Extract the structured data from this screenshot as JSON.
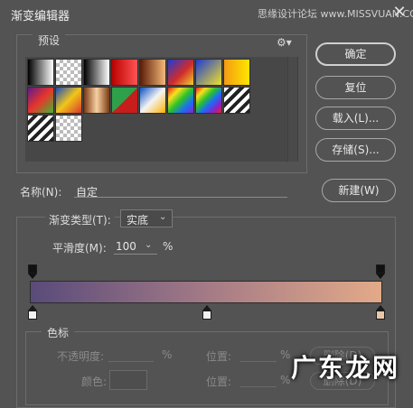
{
  "window": {
    "title": "渐变编辑器",
    "watermark": "思缘设计论坛 www.MISSVUAN.COM",
    "close_glyph": "✕"
  },
  "presets": {
    "label": "预设",
    "gear_glyph": "⚙▾",
    "swatches": [
      "linear-gradient(to right,#000,#fff)",
      "checker",
      "linear-gradient(to right,#000,#fff)",
      "linear-gradient(to right,#b00,#f55)",
      "linear-gradient(to right,#5b1c06,#f4b97a)",
      "linear-gradient(135deg,#1f3bd1 0%,#d12b2b 55%,#f0d12b 100%)",
      "linear-gradient(135deg,#1f3bd1 0%,#f0e12b 100%)",
      "linear-gradient(to right,#f39b12,#ffe600)",
      "linear-gradient(135deg,#5c1a8c 0%,#e8352b 50%,#48b232 100%)",
      "linear-gradient(135deg,#1a4dbf 0%,#f2c519 50%,#d93a2c 100%)",
      "linear-gradient(to right,#7a3a14,#f7d0a2,#7a3a14)",
      "linear-gradient(135deg,#2ea04a 50%,#c81d1d 50%)",
      "linear-gradient(135deg,#0a4fc2,#f4f4f4,#ffb000)",
      "linear-gradient(135deg,#e62222,#f7e11b,#2ac22a,#1b6df7,#8a22c7)",
      "linear-gradient(135deg,#e62222,#f7e11b,#2ac22a,#1b6df7,#8a22c7,#e62222)",
      "repeating-linear-gradient(135deg,#fff 0 4px,#222 4px 8px)",
      "repeating-linear-gradient(135deg,#fff 0 4px,#222 4px 8px)",
      "checker"
    ]
  },
  "buttons": {
    "ok": "确定",
    "reset": "复位",
    "load": "载入(L)...",
    "save": "存储(S)...",
    "new": "新建(W)"
  },
  "name": {
    "label": "名称(N):",
    "value": "自定"
  },
  "gradient_type": {
    "label": "渐变类型(T):",
    "value": "实底",
    "arrow": "⌄"
  },
  "smoothness": {
    "label": "平滑度(M):",
    "value": "100",
    "arrow": "⌄",
    "unit": "%"
  },
  "gradient": {
    "colors": [
      "#594b7a",
      "#a37a86",
      "#e3aa88"
    ],
    "opacity_stops": [
      0,
      100
    ],
    "color_stops": [
      {
        "position_pct": 0,
        "color": "#f2f2f2"
      },
      {
        "position_pct": 50,
        "color": "#f2f2f2"
      },
      {
        "position_pct": 100,
        "color": "#e8c6a6"
      }
    ]
  },
  "stops": {
    "label": "色标",
    "opacity_label": "不透明度:",
    "opacity_unit": "%",
    "location_label": "位置:",
    "location_unit": "%",
    "delete_label": "删除(D)",
    "color_label": "颜色:",
    "location2_label": "位置:",
    "location2_unit": "%",
    "delete2_label": "删除(D)"
  },
  "watermark_logo": "广东龙网"
}
